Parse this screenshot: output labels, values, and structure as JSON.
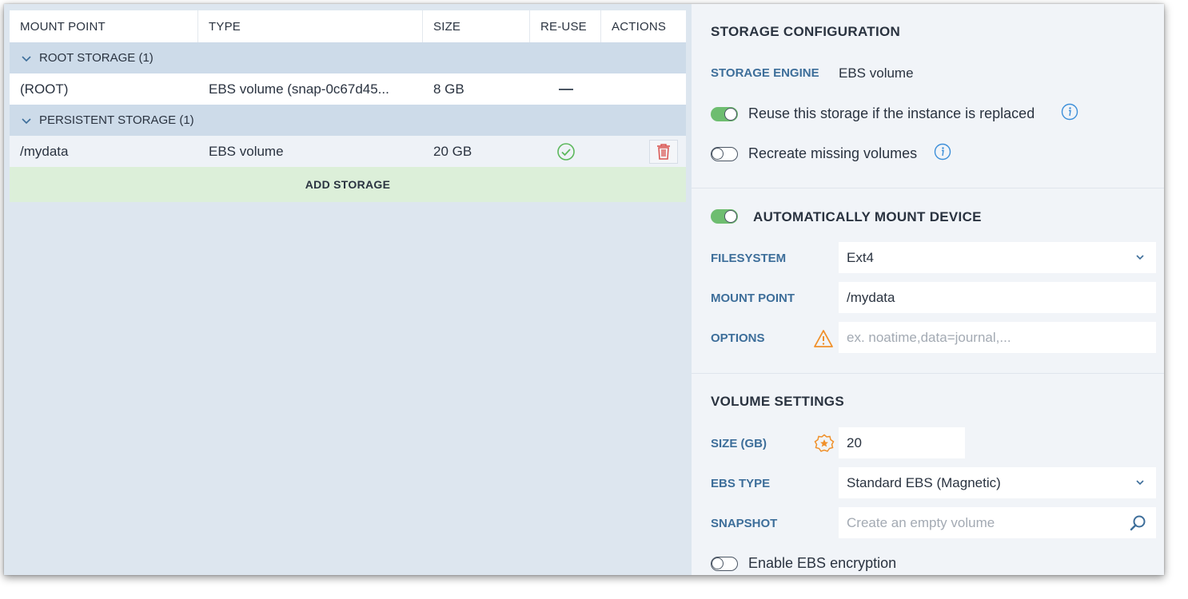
{
  "table": {
    "headers": [
      "MOUNT POINT",
      "TYPE",
      "SIZE",
      "RE-USE",
      "ACTIONS"
    ],
    "groups": [
      {
        "label": "ROOT STORAGE (1)",
        "rows": [
          {
            "mount": "(ROOT)",
            "type": "EBS volume (snap-0c67d45...",
            "size": "8 GB",
            "reuse": "none"
          }
        ]
      },
      {
        "label": "PERSISTENT STORAGE (1)",
        "rows": [
          {
            "mount": "/mydata",
            "type": "EBS volume",
            "size": "20 GB",
            "reuse": "yes"
          }
        ]
      }
    ],
    "add_label": "ADD STORAGE"
  },
  "config": {
    "title": "STORAGE CONFIGURATION",
    "engine_label": "STORAGE ENGINE",
    "engine_value": "EBS volume",
    "reuse_toggle": {
      "label": "Reuse this storage if the instance is replaced",
      "on": true
    },
    "recreate_toggle": {
      "label": "Recreate missing volumes",
      "on": false
    }
  },
  "mount": {
    "title": "AUTOMATICALLY MOUNT DEVICE",
    "on": true,
    "filesystem_label": "FILESYSTEM",
    "filesystem_value": "Ext4",
    "mountpoint_label": "MOUNT POINT",
    "mountpoint_value": "/mydata",
    "options_label": "OPTIONS",
    "options_placeholder": "ex. noatime,data=journal,..."
  },
  "volume": {
    "title": "VOLUME SETTINGS",
    "size_label": "SIZE (GB)",
    "size_value": "20",
    "ebs_type_label": "EBS TYPE",
    "ebs_type_value": "Standard EBS (Magnetic)",
    "snapshot_label": "SNAPSHOT",
    "snapshot_placeholder": "Create an empty volume",
    "encryption_toggle": {
      "label": "Enable EBS encryption",
      "on": false
    }
  },
  "colors": {
    "accent_label": "#3d6e9a",
    "toggle_on": "#6ebd70",
    "add_bg": "#dcefd9",
    "warning": "#f0902a",
    "delete": "#d9534f",
    "check": "#5cb85c"
  }
}
